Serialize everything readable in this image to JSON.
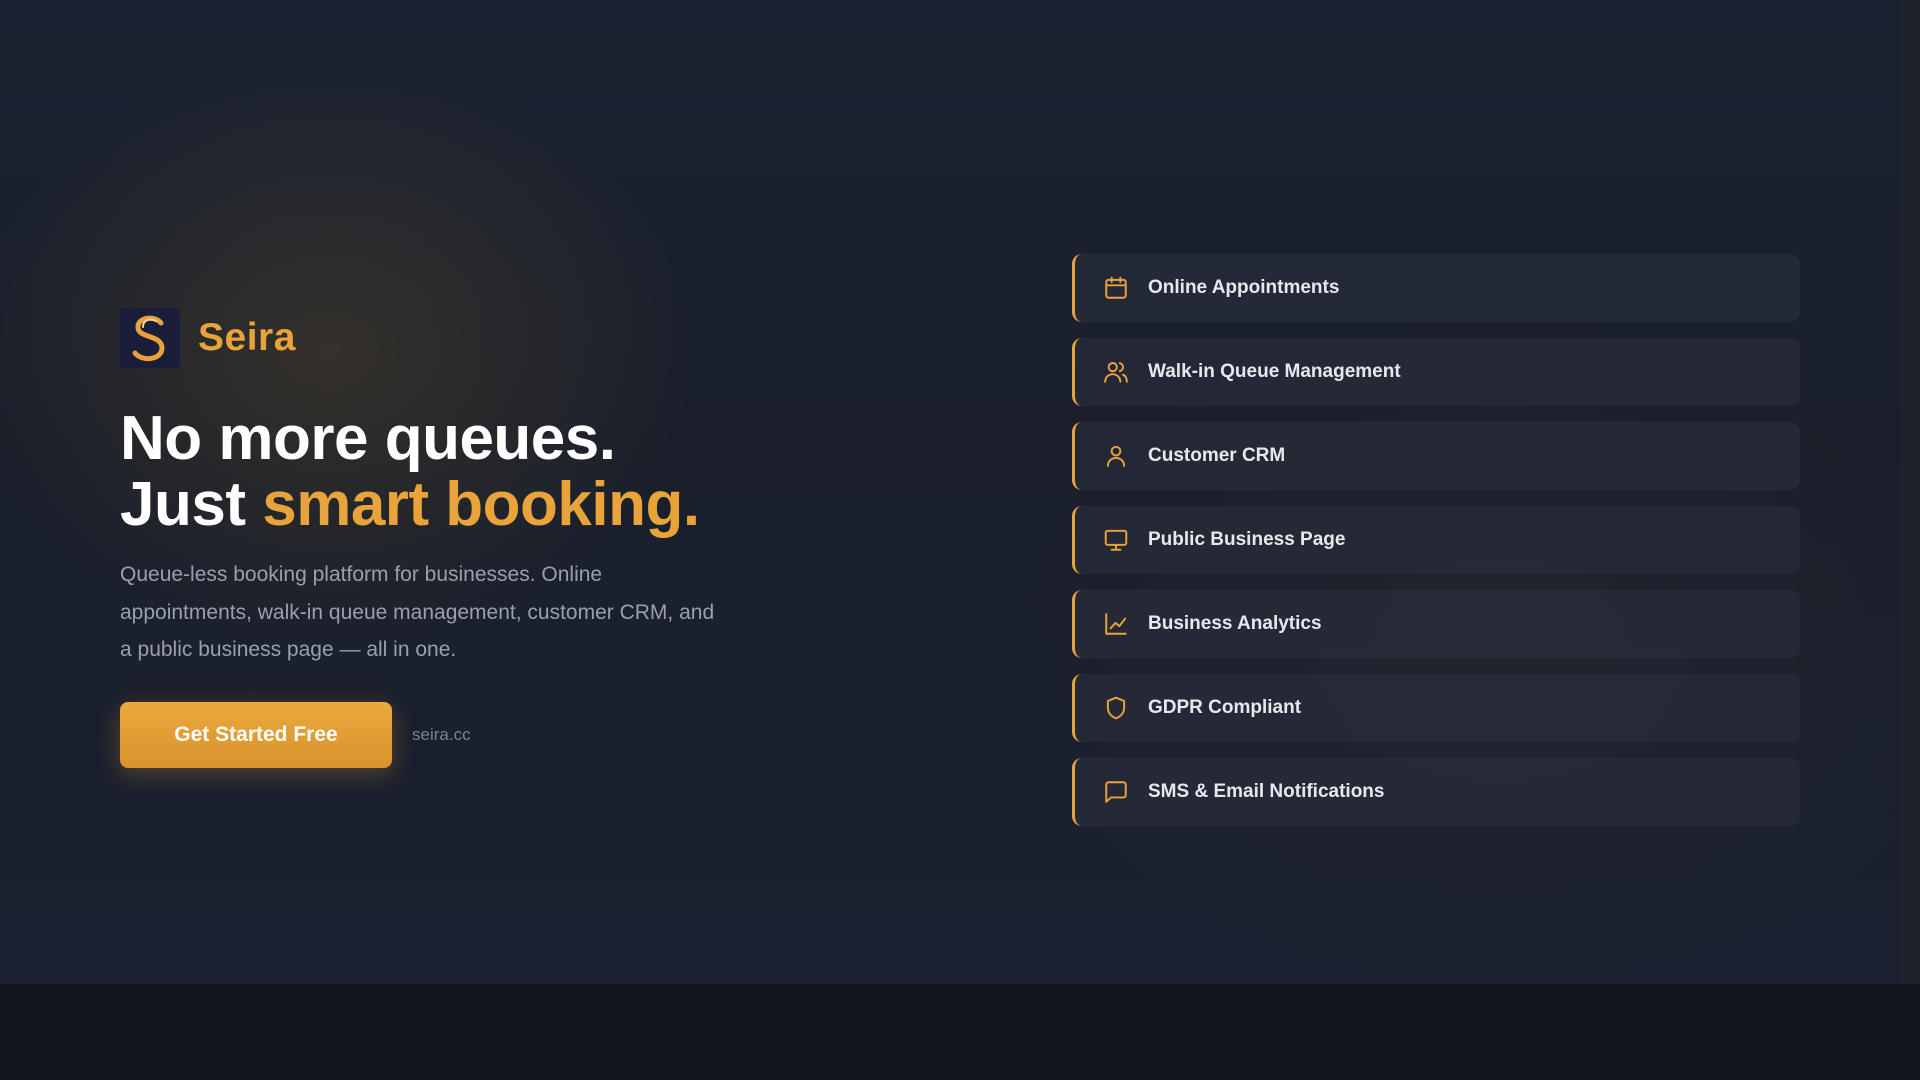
{
  "brand": {
    "name": "Seira",
    "logo_icon": "seira-s-logo"
  },
  "hero": {
    "headline_line1": "No more queues.",
    "headline_line2_plain": "Just ",
    "headline_line2_accent": "smart booking.",
    "description": "Queue-less booking platform for businesses. Online appointments, walk-in queue management, customer CRM, and a public business page — all in one.",
    "cta_label": "Get Started Free",
    "domain_text": "seira.cc"
  },
  "features": [
    {
      "label": "Online Appointments",
      "icon": "calendar-icon"
    },
    {
      "label": "Walk-in Queue Management",
      "icon": "users-icon"
    },
    {
      "label": "Customer CRM",
      "icon": "user-icon"
    },
    {
      "label": "Public Business Page",
      "icon": "monitor-icon"
    },
    {
      "label": "Business Analytics",
      "icon": "line-chart-icon"
    },
    {
      "label": "GDPR Compliant",
      "icon": "shield-icon"
    },
    {
      "label": "SMS & Email Notifications",
      "icon": "message-square-icon"
    }
  ],
  "colors": {
    "accent": "#e8a33b",
    "background": "#1a2231",
    "card": "#282c3a",
    "text": "#ffffff",
    "muted": "#9aa0ab"
  }
}
